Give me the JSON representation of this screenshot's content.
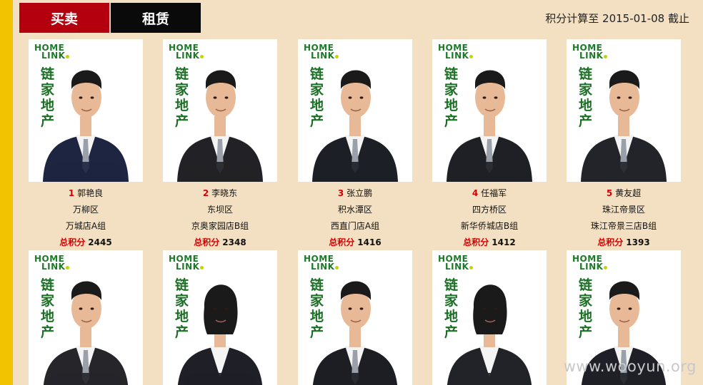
{
  "tabs": {
    "buy": "买卖",
    "rent": "租赁"
  },
  "cutoff_text": "积分计算至 2015-01-08 截止",
  "logo": {
    "line1": "HOME",
    "line2": "LINK",
    "brand": "链家地产"
  },
  "score_label": "总积分",
  "agents_row1": [
    {
      "rank": "1",
      "name": "郭艳良",
      "area": "万柳区",
      "store": "万城店A组",
      "score": "2445"
    },
    {
      "rank": "2",
      "name": "李晓东",
      "area": "东坝区",
      "store": "京奥家园店B组",
      "score": "2348"
    },
    {
      "rank": "3",
      "name": "张立鹏",
      "area": "积水潭区",
      "store": "西直门店A组",
      "score": "1416"
    },
    {
      "rank": "4",
      "name": "任福军",
      "area": "四方桥区",
      "store": "新华侨城店B组",
      "score": "1412"
    },
    {
      "rank": "5",
      "name": "黄友超",
      "area": "珠江帝景区",
      "store": "珠江帝景三店B组",
      "score": "1393"
    }
  ],
  "watermark": "www.wooyun.org",
  "colors": {
    "frame": "#f2c300",
    "panel": "#f3e0c2",
    "buy_tab": "#b4000e",
    "rent_tab": "#0a0a0a",
    "accent_red": "#d60000",
    "brand_green": "#1b6f25"
  }
}
